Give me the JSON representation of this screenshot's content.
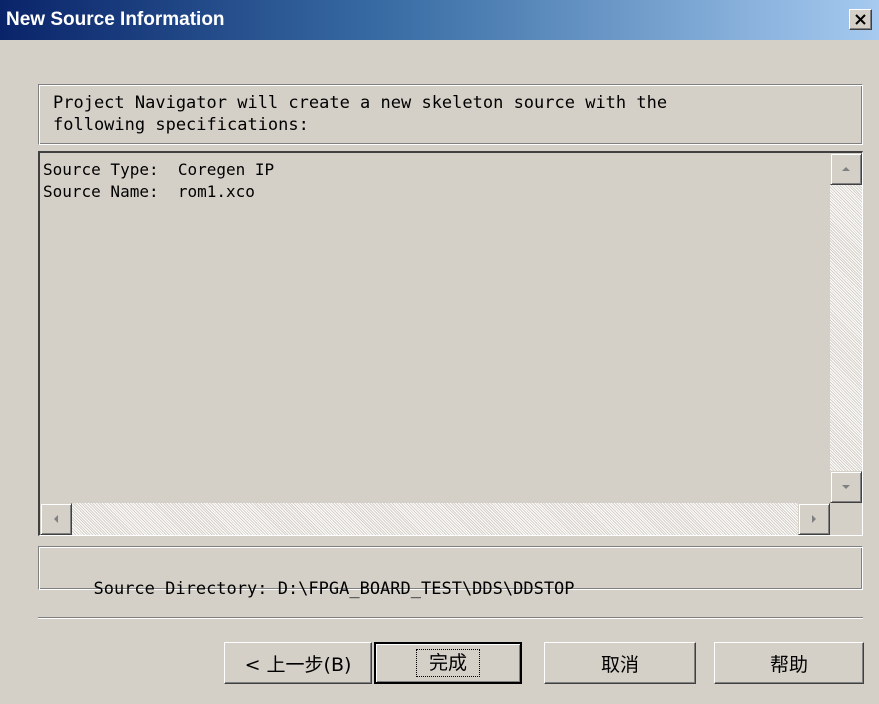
{
  "window": {
    "title": "New Source Information",
    "close_icon": "close-icon"
  },
  "description": {
    "line1": "Project Navigator will create a new skeleton source with the",
    "line2": "following specifications:"
  },
  "specs": {
    "line1": "Source Type:  Coregen IP",
    "line2": "Source Name:  rom1.xco"
  },
  "directory": {
    "text": "Source Directory: D:\\FPGA_BOARD_TEST\\DDS\\DDSTOP"
  },
  "buttons": {
    "back": "< 上一步(B)",
    "finish": "完成",
    "cancel": "取消",
    "help": "帮助"
  },
  "colors": {
    "face": "#d4d0c8",
    "titlebar_start": "#0a246a",
    "titlebar_end": "#a6caf0"
  }
}
